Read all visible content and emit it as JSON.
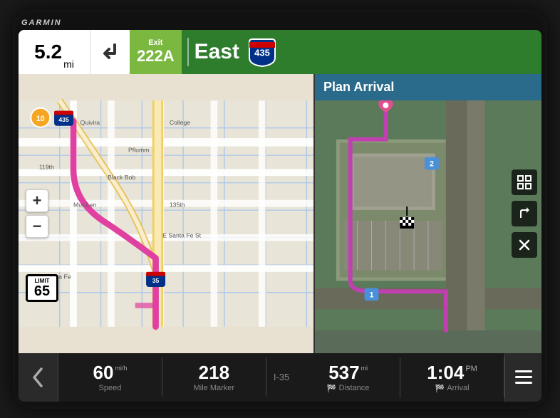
{
  "brand": "GARMIN",
  "nav_bar": {
    "distance": "5.2",
    "distance_unit": "mi",
    "exit_label": "Exit",
    "exit_number": "222A",
    "direction": "East",
    "highway": "435"
  },
  "map_left": {
    "zoom_plus": "+",
    "zoom_minus": "−",
    "speed_limit_label": "LIMIT",
    "speed_limit_value": "65",
    "road_labels": [
      "Quivira",
      "College",
      "Pflumm",
      "Black Bob",
      "Mur-Len",
      "135th",
      "E Santa Fe St",
      "Santa Fe",
      "119th"
    ]
  },
  "map_right": {
    "plan_arrival": "Plan Arrival",
    "waypoints": [
      "1",
      "2"
    ]
  },
  "bottom_bar": {
    "back_arrow": "‹",
    "speed_value": "60",
    "speed_unit": "mi/h",
    "speed_label": "Speed",
    "mile_marker_value": "218",
    "mile_marker_label": "Mile Marker",
    "road_name": "I-35",
    "distance_value": "537",
    "distance_unit": "mi",
    "distance_label": "Distance",
    "arrival_value": "1:04",
    "arrival_unit": "PM",
    "arrival_label": "Arrival",
    "menu_icon": "≡"
  },
  "icons": {
    "zoom_in": "+",
    "zoom_out": "−",
    "map_view": "⊞",
    "route_icon": "↱",
    "close_icon": "✕"
  }
}
